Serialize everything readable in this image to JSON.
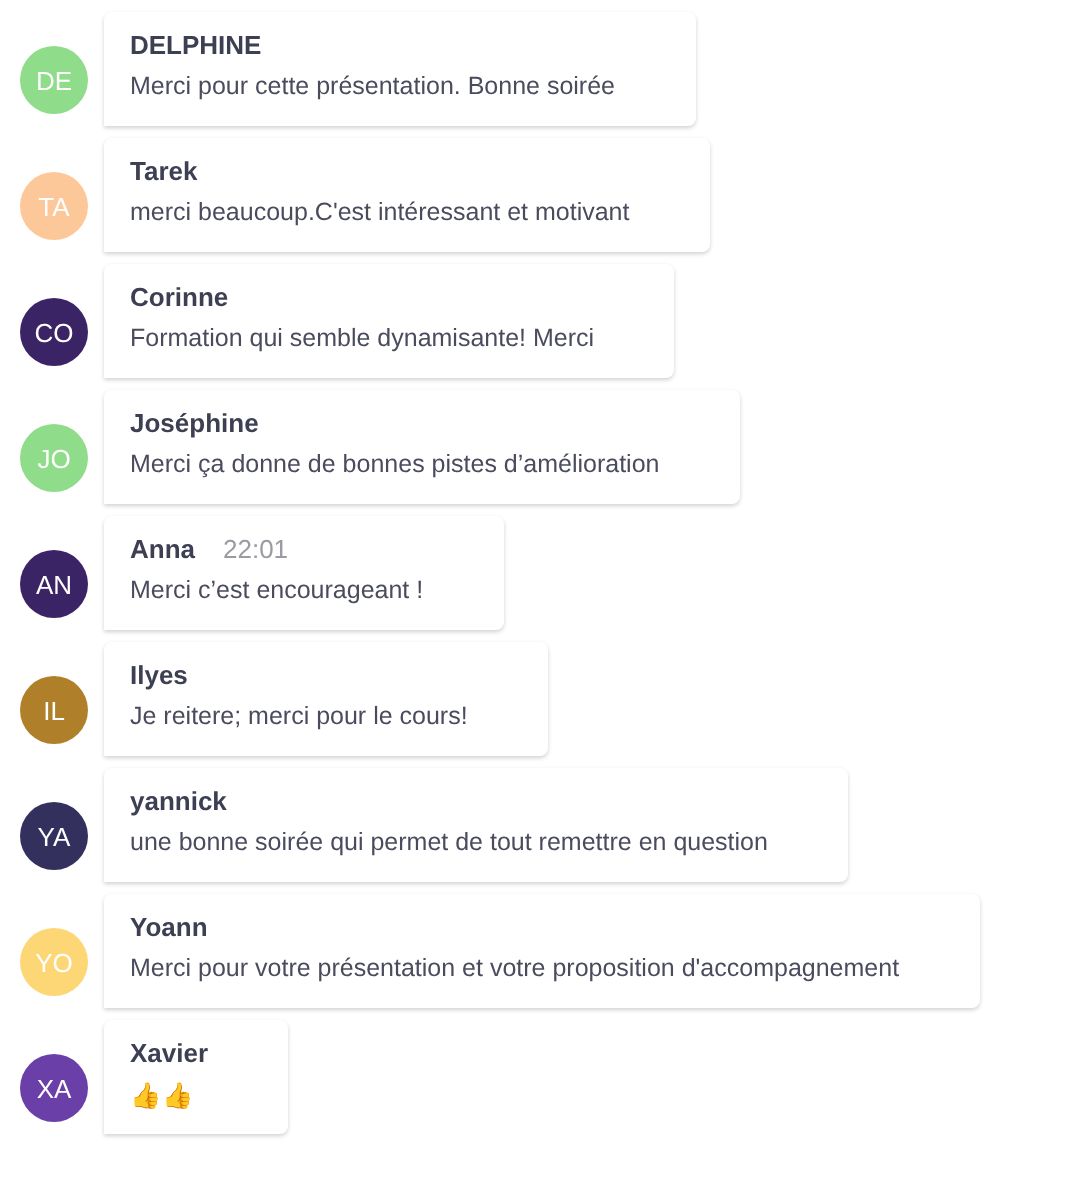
{
  "messages": [
    {
      "initials": "DE",
      "color": "#8fdc8a",
      "author": "DELPHINE",
      "text": "Merci pour cette présentation. Bonne soirée"
    },
    {
      "initials": "TA",
      "color": "#fdc899",
      "author": "Tarek",
      "text": "merci beaucoup.C'est intéressant et motivant"
    },
    {
      "initials": "CO",
      "color": "#3b2466",
      "author": "Corinne",
      "text": "Formation qui semble dynamisante! Merci"
    },
    {
      "initials": "JO",
      "color": "#8fdc8a",
      "author": "Joséphine",
      "text": "Merci ça donne de bonnes pistes d’amélioration"
    },
    {
      "initials": "AN",
      "color": "#3b2466",
      "author": "Anna",
      "time": "22:01",
      "text": "Merci c’est encourageant !"
    },
    {
      "initials": "IL",
      "color": "#b07f2a",
      "author": "Ilyes",
      "text": "Je reitere; merci pour le cours!"
    },
    {
      "initials": "YA",
      "color": "#33305e",
      "author": "yannick",
      "text": "une bonne soirée qui permet de tout remettre en question"
    },
    {
      "initials": "YO",
      "color": "#fdd776",
      "author": "Yoann",
      "text": "Merci pour votre présentation et votre proposition d'accompagnement"
    },
    {
      "initials": "XA",
      "color": "#6a3fa8",
      "author": "Xavier",
      "text": "👍👍"
    }
  ]
}
